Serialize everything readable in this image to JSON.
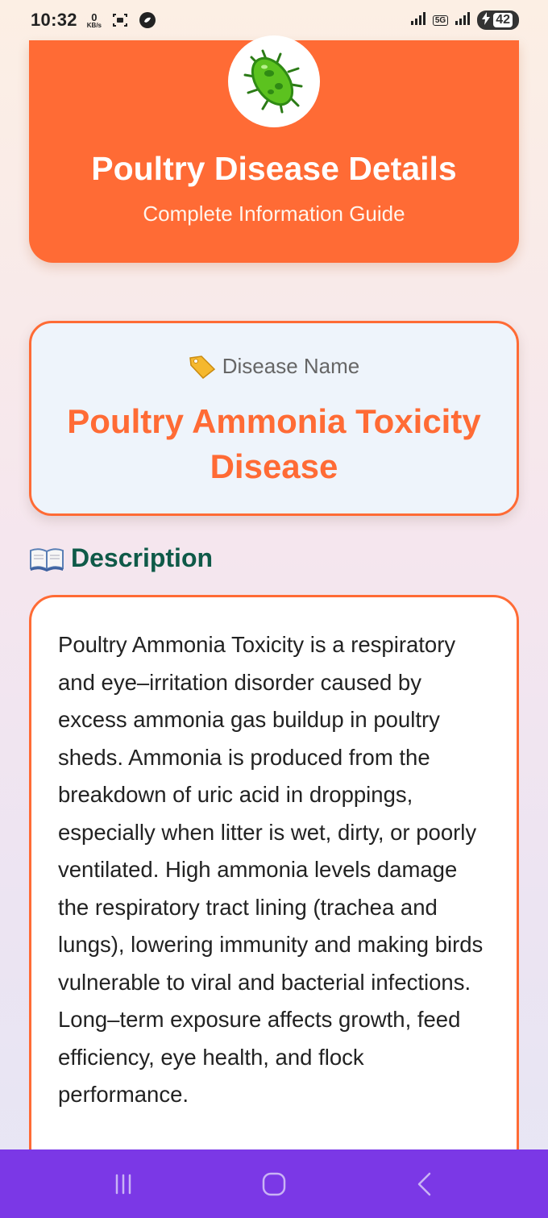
{
  "status_bar": {
    "time": "10:32",
    "net_speed_value": "0",
    "net_speed_unit": "KB/s",
    "network": "5G",
    "battery": "42"
  },
  "header": {
    "logo_icon": "microbe-icon",
    "title": "Poultry Disease Details",
    "subtitle": "Complete Information Guide",
    "background_color": "#ff6b35"
  },
  "disease_card": {
    "label_icon": "tag-icon",
    "label": "Disease Name",
    "name": "Poultry Ammonia Toxicity Disease"
  },
  "description": {
    "heading_icon": "book-icon",
    "heading": "Description",
    "text": "Poultry Ammonia Toxicity is a respiratory and eye–irritation disorder caused by excess ammonia gas buildup in poultry sheds. Ammonia is produced from the breakdown of uric acid in droppings, especially when litter is wet, dirty, or poorly ventilated. High ammonia levels damage the respiratory tract lining (trachea and lungs), lowering immunity and making birds vulnerable to viral and bacterial infections. Long–term exposure affects growth, feed efficiency, eye health, and flock performance."
  },
  "nav_bar": {
    "items": [
      "recents-icon",
      "home-icon",
      "back-icon"
    ],
    "background_color": "#7b38e6"
  }
}
